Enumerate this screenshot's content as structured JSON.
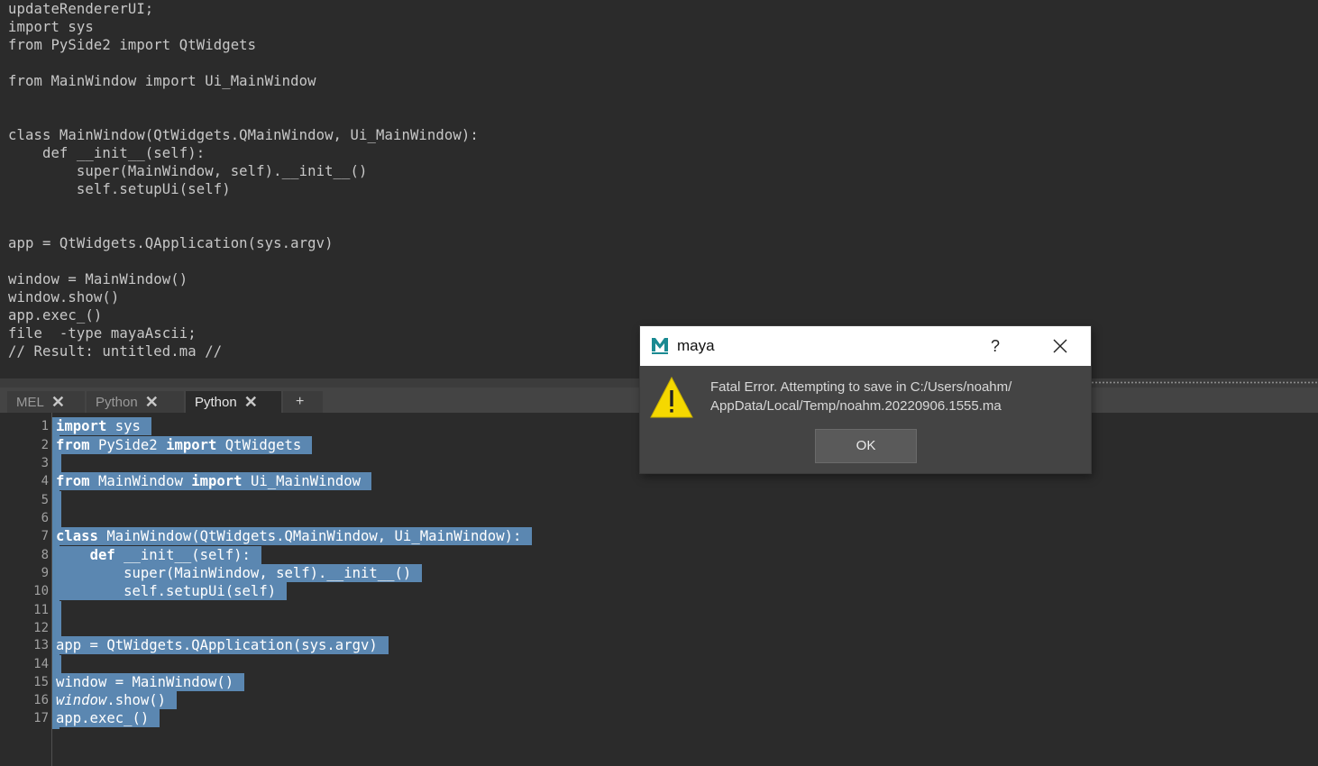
{
  "history": {
    "lines": [
      "updateRendererUI;",
      "import sys",
      "from PySide2 import QtWidgets",
      "",
      "from MainWindow import Ui_MainWindow",
      "",
      "",
      "class MainWindow(QtWidgets.QMainWindow, Ui_MainWindow):",
      "    def __init__(self):",
      "        super(MainWindow, self).__init__()",
      "        self.setupUi(self)",
      "",
      "",
      "app = QtWidgets.QApplication(sys.argv)",
      "",
      "window = MainWindow()",
      "window.show()",
      "app.exec_()",
      "file  -type mayaAscii;",
      "// Result: untitled.ma //"
    ]
  },
  "tabs": [
    {
      "label": "MEL",
      "close": "✕",
      "active": false
    },
    {
      "label": "Python",
      "close": "✕",
      "active": false
    },
    {
      "label": "Python",
      "close": "✕",
      "active": true
    }
  ],
  "add_tab_label": "+",
  "editor": {
    "line_numbers": [
      "1",
      "2",
      "3",
      "4",
      "5",
      "6",
      "7",
      "8",
      "9",
      "10",
      "11",
      "12",
      "13",
      "14",
      "15",
      "16",
      "17"
    ],
    "line1_kw": "import",
    "line1_rest": " sys",
    "line2_kw1": "from",
    "line2_mid": " PySide2 ",
    "line2_kw2": "import",
    "line2_rest": " QtWidgets",
    "line4_kw1": "from",
    "line4_mid": " MainWindow ",
    "line4_kw2": "import",
    "line4_rest": " Ui_MainWindow",
    "line7_kw": "class",
    "line7_rest": " MainWindow(QtWidgets.QMainWindow, Ui_MainWindow):",
    "line8_indent": "    ",
    "line8_kw": "def",
    "line8_rest": " __init__(self):",
    "line9": "        super(MainWindow, self).__init__()",
    "line10": "        self.setupUi(self)",
    "line13": "app = QtWidgets.QApplication(sys.argv)",
    "line15": "window = MainWindow()",
    "line16_it": "window",
    "line16_rest": ".show()",
    "line17": "app.exec_()"
  },
  "dialog": {
    "title": "maya",
    "help": "?",
    "message_line1": "Fatal Error. Attempting to save in C:/Users/noahm/",
    "message_line2": "AppData/Local/Temp/noahm.20220906.1555.ma",
    "ok_label": "OK",
    "warning_color": "#f5d800",
    "app_icon": "maya-logo-icon"
  }
}
